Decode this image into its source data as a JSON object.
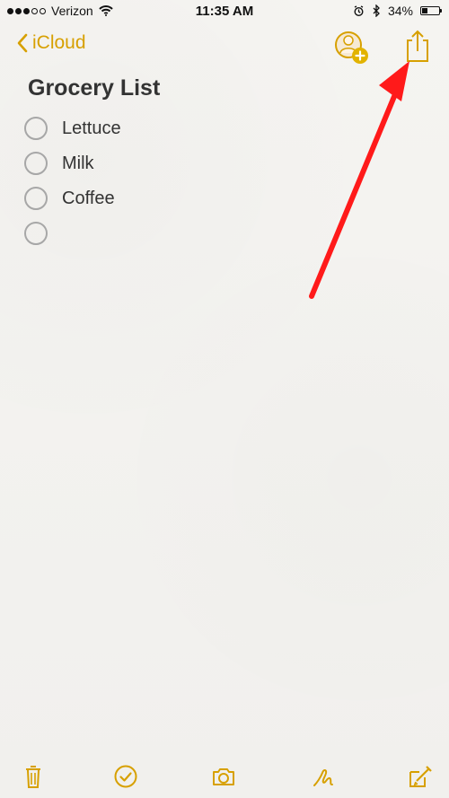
{
  "status_bar": {
    "carrier": "Verizon",
    "time": "11:35 AM",
    "battery": "34%",
    "battery_level": 0.34,
    "signal_filled": 3,
    "signal_total": 5,
    "icons": [
      "wifi-icon",
      "alarm-icon",
      "bluetooth-icon",
      "battery-icon"
    ]
  },
  "nav": {
    "back_label": "iCloud",
    "icons": [
      "chevron-left-icon",
      "add-person-icon",
      "share-icon"
    ]
  },
  "note": {
    "title": "Grocery List",
    "items": [
      {
        "label": "Lettuce",
        "checked": false
      },
      {
        "label": "Milk",
        "checked": false
      },
      {
        "label": "Coffee",
        "checked": false
      },
      {
        "label": "",
        "checked": false
      }
    ]
  },
  "toolbar": {
    "icons": [
      "trash-icon",
      "checklist-icon",
      "camera-icon",
      "sketch-icon",
      "compose-icon"
    ]
  },
  "colors": {
    "accent": "#d7a000",
    "annotation_arrow": "#ff1a1a",
    "background": "#f3f2ef",
    "text": "#333333"
  }
}
